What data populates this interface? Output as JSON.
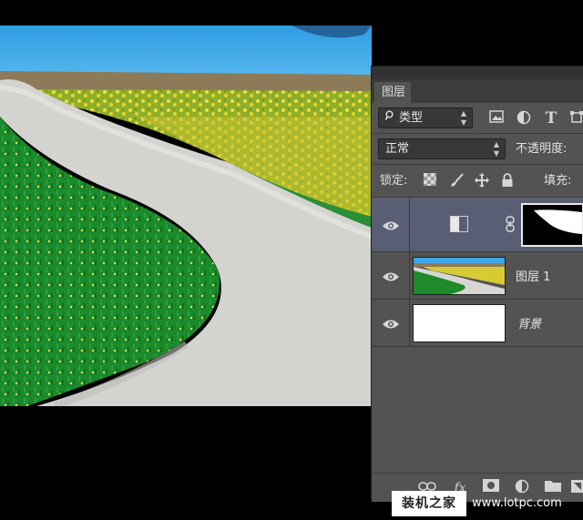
{
  "panel": {
    "tab_label": "图层",
    "filter": {
      "selected": "类型",
      "icons": [
        "image-filter-icon",
        "adjustment-filter-icon",
        "type-filter-icon",
        "shape-filter-icon"
      ]
    },
    "blend_mode": {
      "selected": "正常"
    },
    "opacity_label": "不透明度:",
    "lock_label": "锁定:",
    "fill_label": "填充:",
    "lock_icons": [
      "lock-transparent-pixels-icon",
      "lock-image-pixels-icon",
      "lock-position-icon",
      "lock-all-icon"
    ]
  },
  "layers": [
    {
      "name": "",
      "type": "adjustment",
      "has_mask": true,
      "selected": true,
      "visible": true
    },
    {
      "name": "图层 1",
      "type": "pixel",
      "selected": false,
      "visible": true
    },
    {
      "name": "背景",
      "type": "background",
      "selected": false,
      "visible": true
    }
  ],
  "footer_icons": [
    "link-layers-icon",
    "fx-icon",
    "add-mask-icon",
    "new-adjustment-icon",
    "new-group-icon",
    "new-layer-icon"
  ],
  "footer_fx_label": "fx",
  "watermark": {
    "cn": "装机之家",
    "url": "www.lotpc.com"
  },
  "colors": {
    "panel_bg": "#535353",
    "selected_layer": "#595e75",
    "sky": "#3da8e6",
    "grass": "#1f8a2a",
    "flowers": "#e3d63a",
    "road": "#d4d4d4"
  }
}
